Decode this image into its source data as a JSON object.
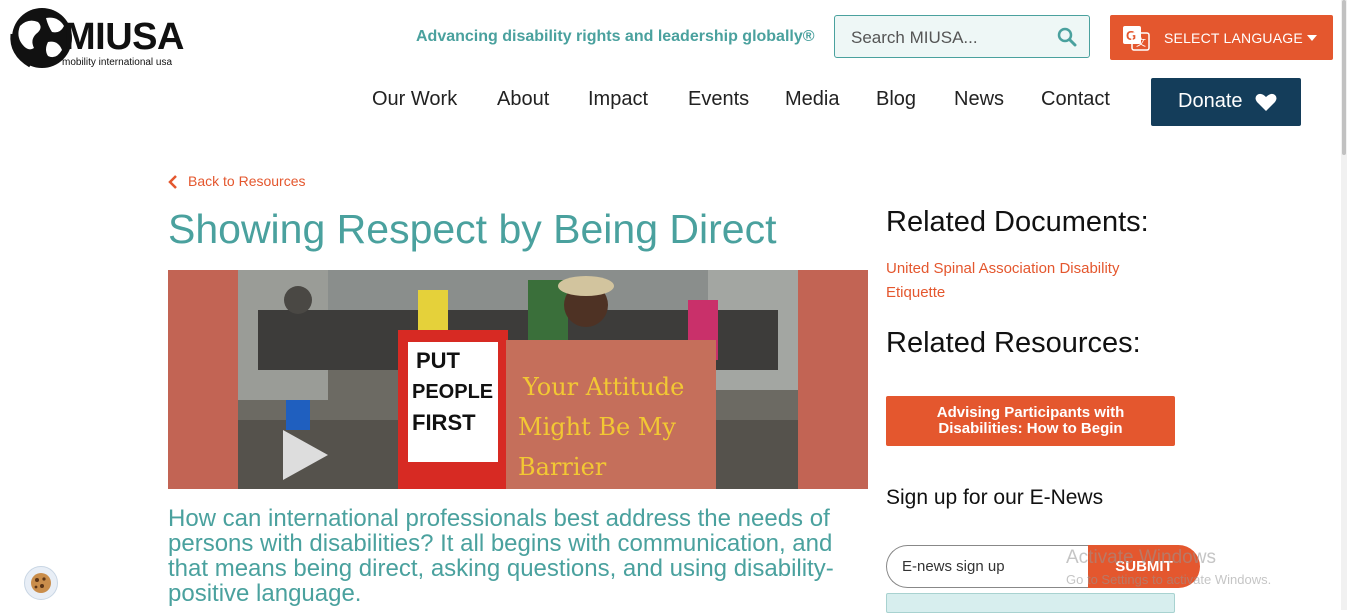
{
  "header": {
    "logo_text": "MIUSA",
    "logo_subtext": "mobility international usa",
    "tagline": "Advancing disability rights and leadership globally®",
    "search": {
      "placeholder": "Search MIUSA..."
    },
    "language_button": "SELECT LANGUAGE"
  },
  "nav": {
    "items": [
      "Our Work",
      "About",
      "Impact",
      "Events",
      "Media",
      "Blog",
      "News",
      "Contact"
    ],
    "donate_label": "Donate"
  },
  "main": {
    "back_link": "Back to Resources",
    "title": "Showing Respect by Being Direct",
    "hero_sign_left": "PUT PEOPLE FIRST",
    "hero_sign_right": "Your Attitude Might Be My Barrier",
    "intro": "How can international professionals best address the needs of persons with disabilities? It all begins with communication, and that means being direct, asking questions, and using disability-positive language."
  },
  "sidebar": {
    "related_documents_heading": "Related Documents:",
    "related_document_link": "United Spinal Association Disability Etiquette",
    "related_resources_heading": "Related Resources:",
    "related_resource_button": "Advising Participants with Disabilities: How to Begin",
    "enews_heading": "Sign up for our E-News",
    "enews_placeholder": "E-news sign up",
    "submit_label": "SUBMIT"
  },
  "overlay": {
    "watermark_title": "Activate Windows",
    "watermark_sub": "Go to Settings to activate Windows."
  },
  "colors": {
    "teal": "#4aa19e",
    "orange": "#e4572e",
    "navy": "#143d5a"
  },
  "icons": [
    "globe-logo-icon",
    "search-icon",
    "google-translate-icon",
    "heart-icon",
    "chevron-left-icon",
    "cookie-icon"
  ]
}
